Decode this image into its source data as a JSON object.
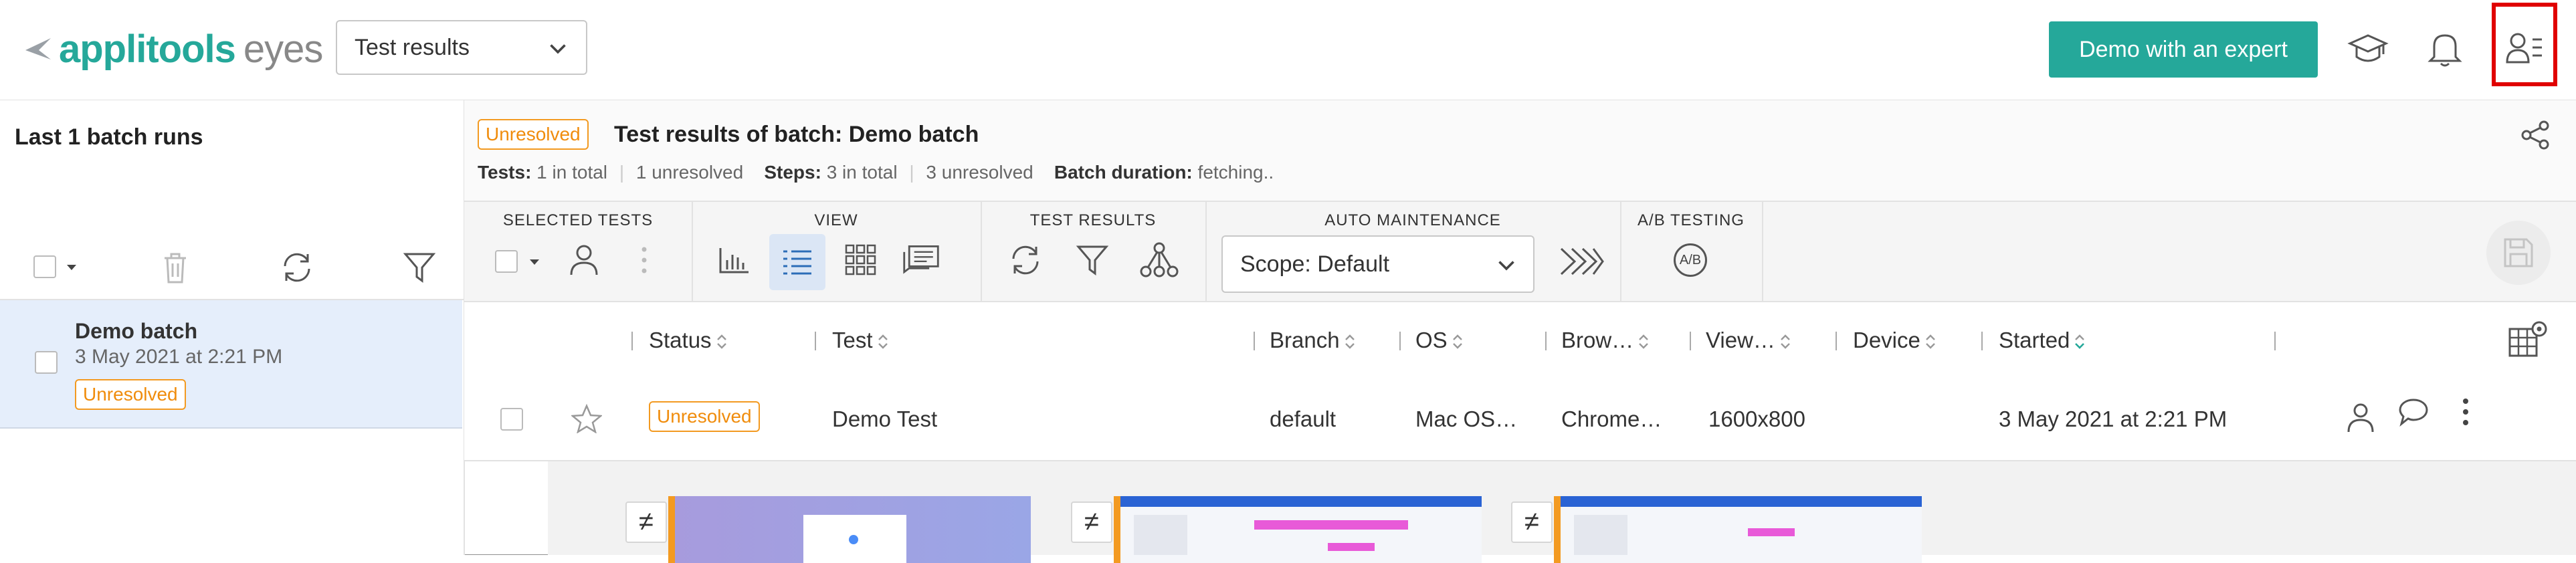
{
  "brand": {
    "name": "applitools",
    "product": "eyes"
  },
  "header": {
    "view_select": "Test results",
    "demo_button": "Demo with an expert"
  },
  "left_panel": {
    "title": "Last 1 batch runs",
    "batch": {
      "name": "Demo batch",
      "date": "3 May 2021 at 2:21 PM",
      "status": "Unresolved"
    }
  },
  "batch_header": {
    "status": "Unresolved",
    "title": "Test results of batch: Demo batch",
    "tests_label": "Tests:",
    "tests_total": "1 in total",
    "tests_unresolved": "1 unresolved",
    "steps_label": "Steps:",
    "steps_total": "3 in total",
    "steps_unresolved": "3 unresolved",
    "duration_label": "Batch duration:",
    "duration_value": "fetching.."
  },
  "toolbar": {
    "selected_tests": "SELECTED TESTS",
    "view": "VIEW",
    "test_results": "TEST RESULTS",
    "auto_maintenance": "AUTO MAINTENANCE",
    "ab_testing": "A/B TESTING",
    "scope": "Scope: Default",
    "ab_icon": "A/B"
  },
  "columns": [
    "Status",
    "Test",
    "Branch",
    "OS",
    "Brow…",
    "View…",
    "Device",
    "Started"
  ],
  "rows": [
    {
      "status": "Unresolved",
      "test": "Demo Test",
      "branch": "default",
      "os": "Mac OS…",
      "browser": "Chrome…",
      "viewport": "1600x800",
      "device": "",
      "started": "3 May 2021 at 2:21 PM"
    }
  ],
  "diff_symbol": "≠",
  "colors": {
    "accent": "#25a89a",
    "unresolved": "#f08c0c",
    "highlight": "#e00000",
    "selected_row": "#e5eefb"
  }
}
